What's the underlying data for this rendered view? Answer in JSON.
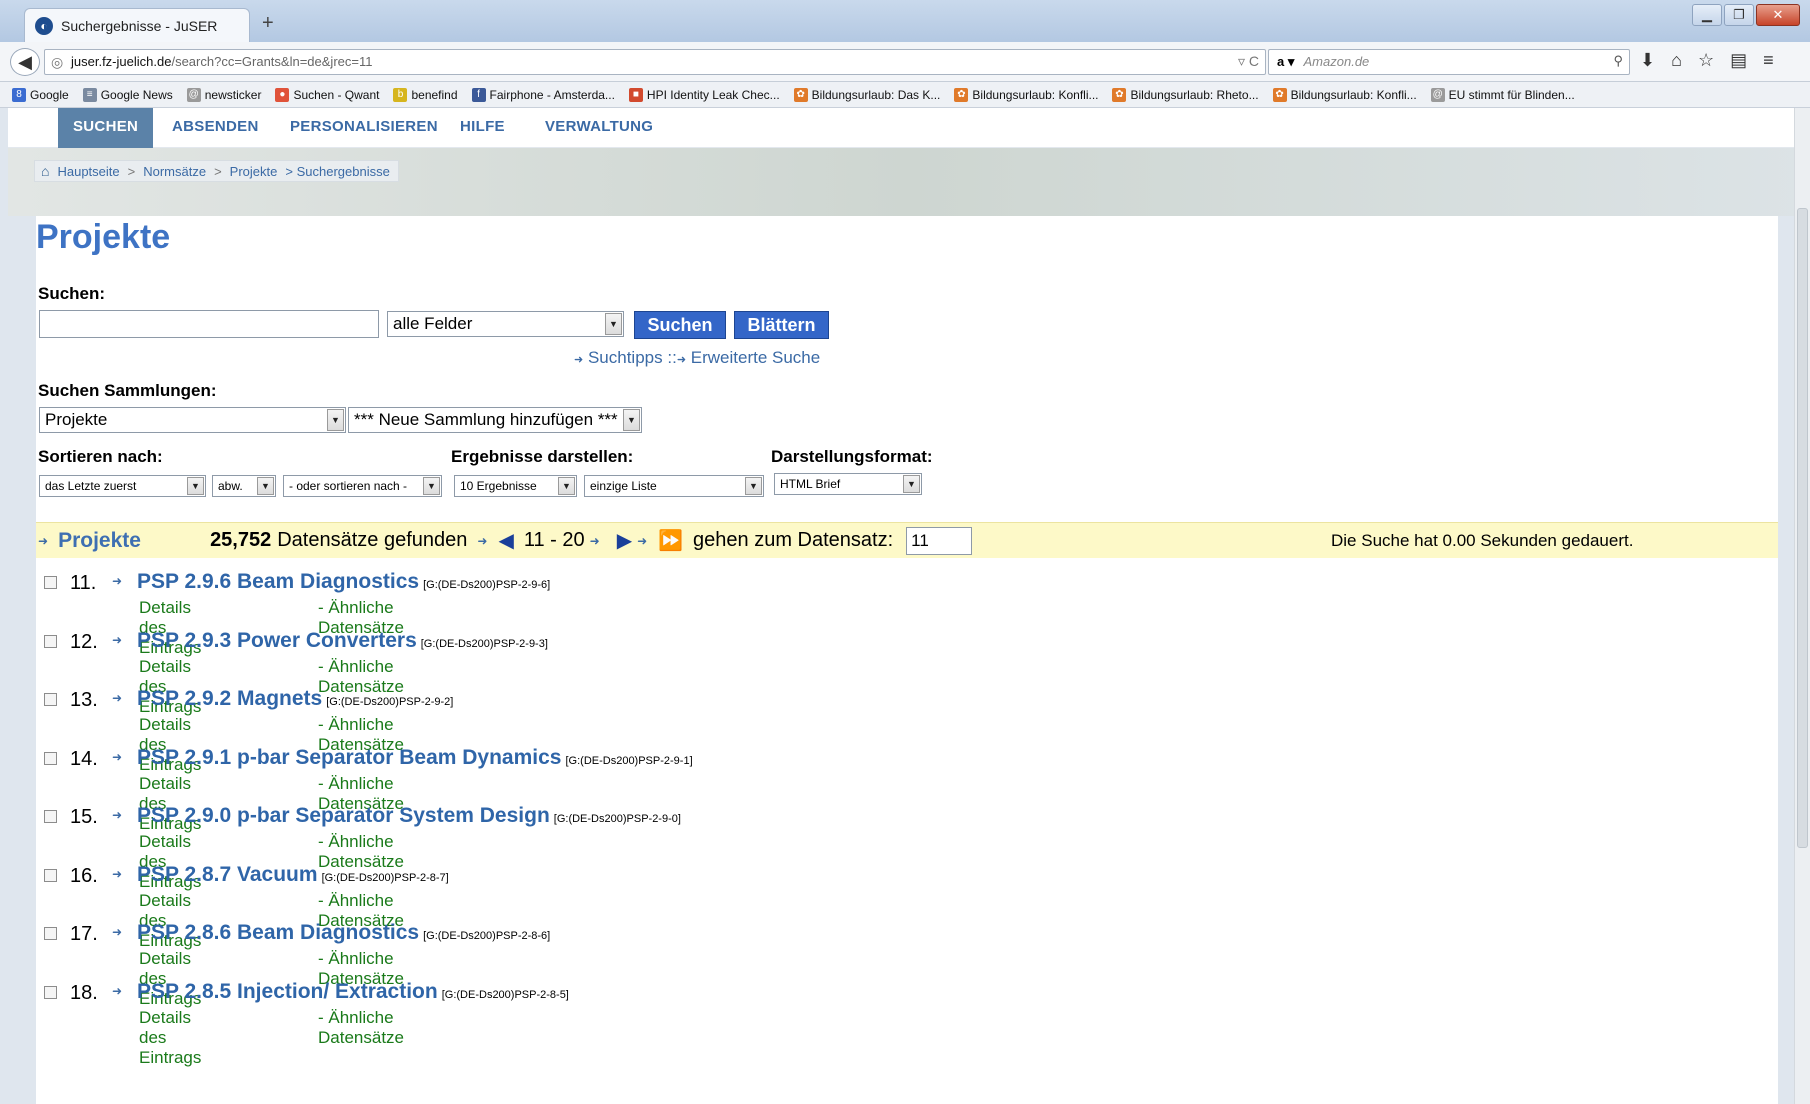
{
  "browser": {
    "tab_title": "Suchergebnisse - JuSER",
    "url_host": "juser.fz-juelich.de",
    "url_path": "/search?cc=Grants&ln=de&jrec=11",
    "search_engine_placeholder": "Amazon.de",
    "bookmarks": [
      {
        "label": "Google",
        "color": "#3b6cd1",
        "glyph": "8"
      },
      {
        "label": "Google News",
        "color": "#7a8aa0",
        "glyph": "≡"
      },
      {
        "label": "newsticker",
        "color": "#9a9a9a",
        "glyph": "@"
      },
      {
        "label": "Suchen - Qwant",
        "color": "#e0533a",
        "glyph": "●"
      },
      {
        "label": "benefind",
        "color": "#d6b51e",
        "glyph": "b"
      },
      {
        "label": "Fairphone - Amsterda...",
        "color": "#3b5998",
        "glyph": "f"
      },
      {
        "label": "HPI Identity Leak Chec...",
        "color": "#d24a2e",
        "glyph": "■"
      },
      {
        "label": "Bildungsurlaub: Das K...",
        "color": "#e07a2a",
        "glyph": "✿"
      },
      {
        "label": "Bildungsurlaub: Konfli...",
        "color": "#e07a2a",
        "glyph": "✿"
      },
      {
        "label": "Bildungsurlaub: Rheto...",
        "color": "#e07a2a",
        "glyph": "✿"
      },
      {
        "label": "Bildungsurlaub: Konfli...",
        "color": "#e07a2a",
        "glyph": "✿"
      },
      {
        "label": "EU stimmt für Blinden...",
        "color": "#9a9a9a",
        "glyph": "@"
      }
    ]
  },
  "menu": {
    "suchen": "SUCHEN",
    "absenden": "ABSENDEN",
    "personalisieren": "PERSONALISIEREN",
    "hilfe": "HILFE",
    "verwaltung": "VERWALTUNG"
  },
  "breadcrumb": {
    "home": "Hauptseite",
    "sep": ">",
    "normsaetze": "Normsätze",
    "projekte": "Projekte",
    "current": "> Suchergebnisse"
  },
  "page": {
    "title": "Projekte",
    "search_label": "Suchen:",
    "search_value": "",
    "field_select": "alle Felder",
    "btn_search": "Suchen",
    "btn_browse": "Blättern",
    "tips_link": "Suchtipps",
    "tips_sep": "::",
    "advanced_link": "Erweiterte Suche",
    "collections_label": "Suchen Sammlungen:",
    "collection_select": "Projekte",
    "add_collection": "*** Neue Sammlung hinzufügen ***",
    "sort_label": "Sortieren nach:",
    "sort_select": "das Letzte zuerst",
    "sort_order": "abw.",
    "sort_alt": "- oder sortieren nach -",
    "results_label": "Ergebnisse darstellen:",
    "results_count_select": "10 Ergebnisse",
    "results_list_select": "einzige Liste",
    "format_label": "Darstellungsformat:",
    "format_select": "HTML Brief"
  },
  "resultbar": {
    "collection": "Projekte",
    "count": "25,752",
    "found_text": "Datensätze gefunden",
    "range": "11 - 20",
    "goto_label": "gehen zum Datensatz:",
    "goto_value": "11",
    "time_text": "Die Suche hat 0.00 Sekunden gedauert."
  },
  "records": [
    {
      "num": "11.",
      "title": "PSP 2.9.6 Beam Diagnostics",
      "id": "[G:(DE-Ds200)PSP-2-9-6]",
      "details": "Details des Eintrags",
      "similar": "- Ähnliche Datensätze"
    },
    {
      "num": "12.",
      "title": "PSP 2.9.3 Power Converters",
      "id": "[G:(DE-Ds200)PSP-2-9-3]",
      "details": "Details des Eintrags",
      "similar": "- Ähnliche Datensätze"
    },
    {
      "num": "13.",
      "title": "PSP 2.9.2 Magnets",
      "id": "[G:(DE-Ds200)PSP-2-9-2]",
      "details": "Details des Eintrags",
      "similar": "- Ähnliche Datensätze"
    },
    {
      "num": "14.",
      "title": "PSP 2.9.1 p-bar Separator Beam Dynamics",
      "id": "[G:(DE-Ds200)PSP-2-9-1]",
      "details": "Details des Eintrags",
      "similar": "- Ähnliche Datensätze"
    },
    {
      "num": "15.",
      "title": "PSP 2.9.0 p-bar Separator System Design",
      "id": "[G:(DE-Ds200)PSP-2-9-0]",
      "details": "Details des Eintrags",
      "similar": "- Ähnliche Datensätze"
    },
    {
      "num": "16.",
      "title": "PSP 2.8.7 Vacuum",
      "id": "[G:(DE-Ds200)PSP-2-8-7]",
      "details": "Details des Eintrags",
      "similar": "- Ähnliche Datensätze"
    },
    {
      "num": "17.",
      "title": "PSP 2.8.6 Beam Diagnostics",
      "id": "[G:(DE-Ds200)PSP-2-8-6]",
      "details": "Details des Eintrags",
      "similar": "- Ähnliche Datensätze"
    },
    {
      "num": "18.",
      "title": "PSP 2.8.5 Injection/ Extraction",
      "id": "[G:(DE-Ds200)PSP-2-8-5]",
      "details": "Details des Eintrags",
      "similar": "- Ähnliche Datensätze"
    }
  ]
}
